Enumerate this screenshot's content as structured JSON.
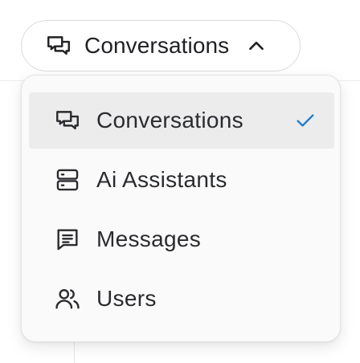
{
  "trigger": {
    "label": "Conversations",
    "icon": "chat-bubbles-icon",
    "expanded_icon": "chevron-up-icon"
  },
  "menu": {
    "items": [
      {
        "label": "Conversations",
        "icon": "chat-bubbles-icon",
        "selected": true
      },
      {
        "label": "Ai Assistants",
        "icon": "server-icon",
        "selected": false
      },
      {
        "label": "Messages",
        "icon": "message-lines-icon",
        "selected": false
      },
      {
        "label": "Users",
        "icon": "users-icon",
        "selected": false
      }
    ],
    "check_icon": "checkmark-icon"
  },
  "colors": {
    "text": "#202124",
    "check_accent": "#1f7ac8",
    "selected_bg": "#ececed",
    "menu_bg": "#fafafa"
  }
}
